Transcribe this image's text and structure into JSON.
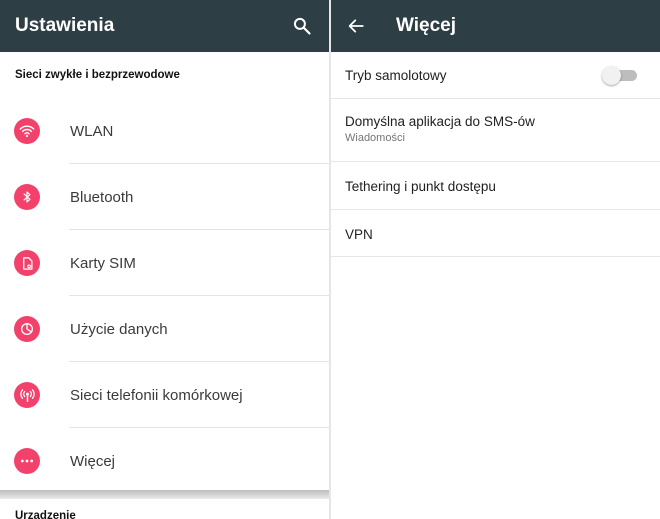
{
  "left": {
    "title": "Ustawienia",
    "search_icon": "search-icon",
    "section_title": "Sieci zwykłe i bezprzewodowe",
    "items": [
      {
        "label": "WLAN",
        "icon": "wifi-icon"
      },
      {
        "label": "Bluetooth",
        "icon": "bluetooth-icon"
      },
      {
        "label": "Karty SIM",
        "icon": "sim-card-icon"
      },
      {
        "label": "Użycie danych",
        "icon": "data-usage-icon"
      },
      {
        "label": "Sieci telefonii komórkowej",
        "icon": "cellular-network-icon"
      },
      {
        "label": "Więcej",
        "icon": "more-icon"
      }
    ],
    "next_section_title": "Urządzenie"
  },
  "right": {
    "title": "Więcej",
    "back_icon": "arrow-back-icon",
    "items": [
      {
        "label": "Tryb samolotowy",
        "toggle_on": false
      },
      {
        "label": "Domyślna aplikacja do SMS-ów",
        "subtitle": "Wiadomości"
      },
      {
        "label": "Tethering i punkt dostępu"
      },
      {
        "label": "VPN"
      }
    ]
  },
  "colors": {
    "app_bar": "#2d3e45",
    "accent": "#f2426b"
  }
}
